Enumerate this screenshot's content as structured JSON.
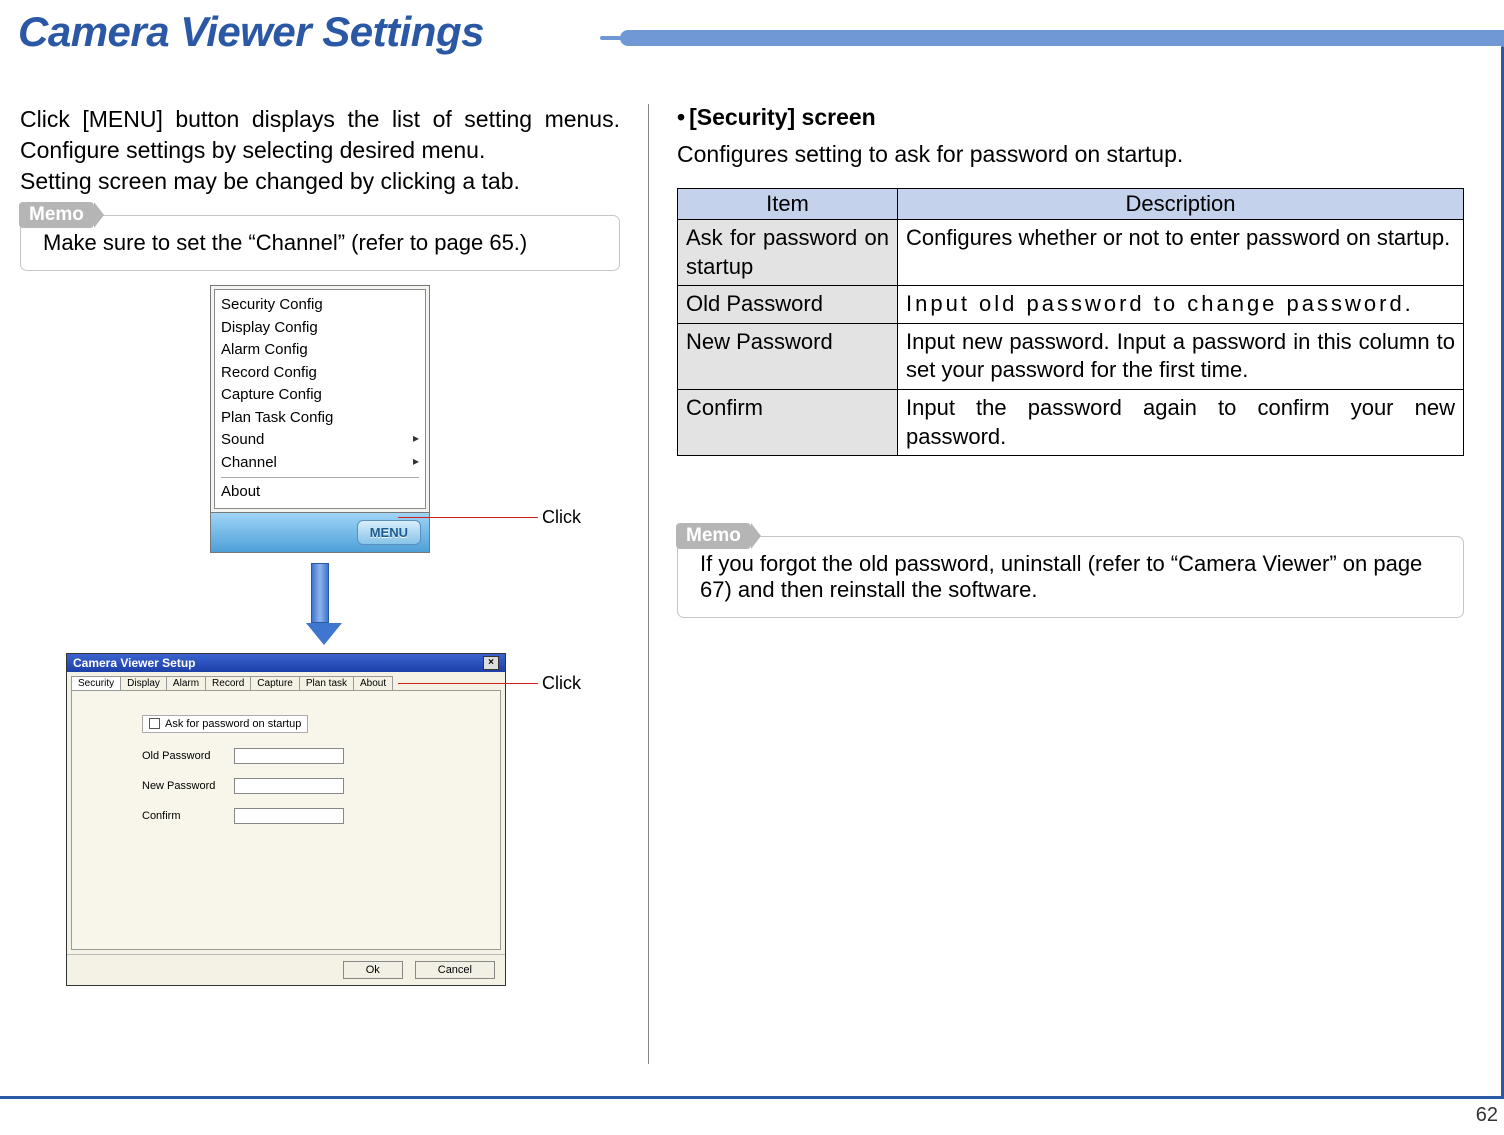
{
  "page": {
    "title": "Camera Viewer Settings",
    "number": "62"
  },
  "left": {
    "intro_line1": "Click [MENU] button displays the list of setting menus. Configure settings by selecting desired menu.",
    "intro_line2": "Setting screen may be changed by clicking a tab.",
    "memo_label": "Memo",
    "memo_text": "Make sure to set the “Channel” (refer to page 65.)",
    "click_label": "Click",
    "menu": {
      "button": "MENU",
      "items": [
        "Security Config",
        "Display Config",
        "Alarm Config",
        "Record Config",
        "Capture Config",
        "Plan Task Config",
        "Sound",
        "Channel",
        "About"
      ]
    },
    "dialog": {
      "title": "Camera Viewer Setup",
      "tabs": [
        "Security",
        "Display",
        "Alarm",
        "Record",
        "Capture",
        "Plan task",
        "About"
      ],
      "ask_label": "Ask for password on startup",
      "fields": {
        "old": "Old Password",
        "new": "New Password",
        "confirm": "Confirm"
      },
      "ok": "Ok",
      "cancel": "Cancel"
    }
  },
  "right": {
    "sec_title": "[Security] screen",
    "sec_desc": "Configures setting to ask for password on startup.",
    "table": {
      "head_item": "Item",
      "head_desc": "Description",
      "rows": [
        {
          "item": "Ask for password on startup",
          "desc": "Configures whether or not to enter password on startup."
        },
        {
          "item": "Old Password",
          "desc": "Input old password to change password."
        },
        {
          "item": "New Password",
          "desc": "Input new password. Input a password in this column to set your password for the first time."
        },
        {
          "item": "Confirm",
          "desc": "Input the password again to confirm your new password."
        }
      ]
    },
    "memo_label": "Memo",
    "memo_text": "If you forgot the old password, uninstall (refer to “Camera Viewer” on page 67) and then reinstall the software."
  }
}
